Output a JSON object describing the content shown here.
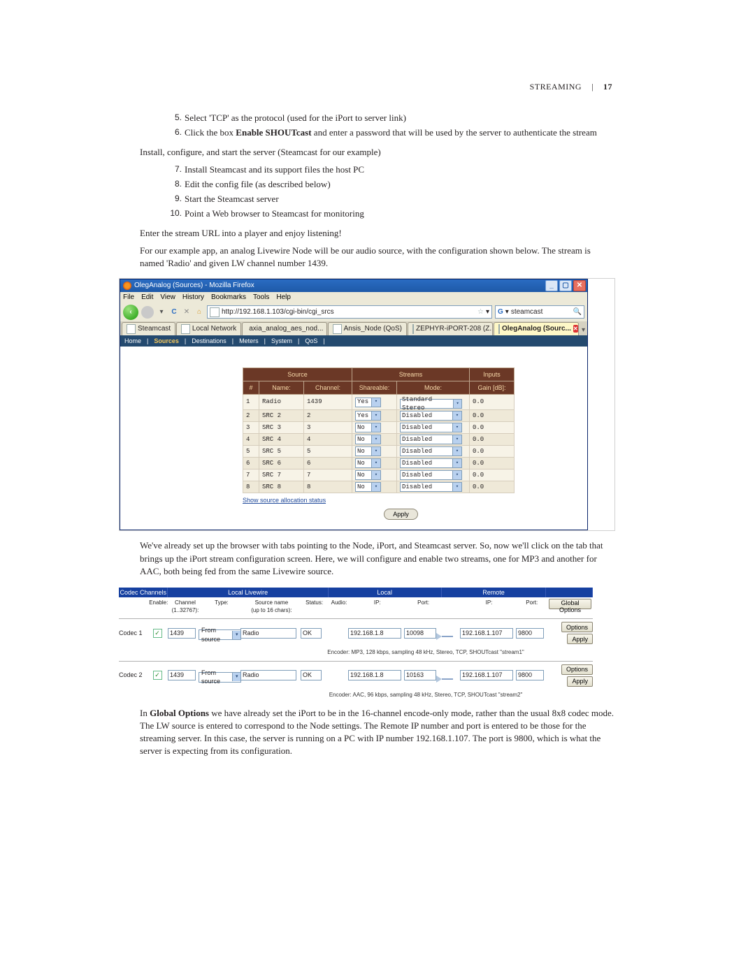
{
  "pageHeader": {
    "section": "STREAMING",
    "sep": "|",
    "pageNum": "17"
  },
  "instrFirst": [
    {
      "n": "5.",
      "text": "Select 'TCP' as the protocol (used for the iPort to server link)"
    },
    {
      "n": "6.",
      "text_pre": "Click the box ",
      "bold": "Enable SHOUTcast",
      "text_post": " and enter a password that will be used by the server to authenticate the stream"
    }
  ],
  "paraInstall": "Install, configure, and start the server (Steamcast for our example)",
  "instrSecond": [
    {
      "n": "7.",
      "text": "Install Steamcast and its support files the host PC"
    },
    {
      "n": "8.",
      "text": "Edit the config file (as described below)"
    },
    {
      "n": "9.",
      "text": "Start the Steamcast server"
    },
    {
      "n": "10.",
      "text": "Point a Web browser to Steamcast for monitoring"
    }
  ],
  "paraEnter": "Enter the stream URL into a player and enjoy listening!",
  "paraExample": "For our example app, an analog Livewire Node will be our audio source, with the configuration shown below. The stream is named 'Radio' and given LW channel number 1439.",
  "firefox": {
    "title": "OlegAnalog (Sources) - Mozilla Firefox",
    "menu": [
      "File",
      "Edit",
      "View",
      "History",
      "Bookmarks",
      "Tools",
      "Help"
    ],
    "url": "http://192.168.1.103/cgi-bin/cgi_srcs",
    "search": "steamcast",
    "tabs": [
      {
        "label": "Steamcast"
      },
      {
        "label": "Local Network"
      },
      {
        "label": "axia_analog_aes_nod..."
      },
      {
        "label": "Ansis_Node (QoS)"
      },
      {
        "label": "ZEPHYR-iPORT-208 (Z..."
      },
      {
        "label": "OlegAnalog (Sourc...",
        "active": true
      }
    ],
    "subnav": [
      "Home",
      "Sources",
      "Destinations",
      "Meters",
      "System",
      "QoS"
    ],
    "tableHead": {
      "group1": "Source",
      "group2": "Streams",
      "group3": "Inputs",
      "c_num": "#",
      "c_name": "Name:",
      "c_channel": "Channel:",
      "c_share": "Shareable:",
      "c_mode": "Mode:",
      "c_gain": "Gain [dB]:"
    },
    "rows": [
      {
        "n": "1",
        "name": "Radio",
        "chan": "1439",
        "share": "Yes",
        "mode": "Standard Stereo",
        "gain": "0.0"
      },
      {
        "n": "2",
        "name": "SRC 2",
        "chan": "2",
        "share": "Yes",
        "mode": "Disabled",
        "gain": "0.0"
      },
      {
        "n": "3",
        "name": "SRC 3",
        "chan": "3",
        "share": "No",
        "mode": "Disabled",
        "gain": "0.0"
      },
      {
        "n": "4",
        "name": "SRC 4",
        "chan": "4",
        "share": "No",
        "mode": "Disabled",
        "gain": "0.0"
      },
      {
        "n": "5",
        "name": "SRC 5",
        "chan": "5",
        "share": "No",
        "mode": "Disabled",
        "gain": "0.0"
      },
      {
        "n": "6",
        "name": "SRC 6",
        "chan": "6",
        "share": "No",
        "mode": "Disabled",
        "gain": "0.0"
      },
      {
        "n": "7",
        "name": "SRC 7",
        "chan": "7",
        "share": "No",
        "mode": "Disabled",
        "gain": "0.0"
      },
      {
        "n": "8",
        "name": "SRC 8",
        "chan": "8",
        "share": "No",
        "mode": "Disabled",
        "gain": "0.0"
      }
    ],
    "linkAlloc": "Show source allocation status",
    "apply": "Apply"
  },
  "paraBrowser": "We've already set up the browser with tabs pointing to the Node, iPort, and Steamcast server. So, now we'll click on the tab that brings up the iPort stream configuration screen. Here, we will  configure and enable two streams, one for MP3 and another for AAC, both being fed from the same Livewire source.",
  "codec": {
    "head": {
      "c1": "Codec Channels",
      "c2": "Local Livewire",
      "c3": "Local",
      "c4": "Remote"
    },
    "sub": {
      "enable": "Enable:",
      "channel_l1": "Channel",
      "channel_l2": "(1..32767):",
      "type": "Type:",
      "srcname_l1": "Source name",
      "srcname_l2": "(up to 16 chars):",
      "status": "Status:",
      "audio": "Audio:",
      "ip": "IP:",
      "port": "Port:",
      "rip": "IP:",
      "rport": "Port:",
      "global": "Global Options"
    },
    "rows": [
      {
        "label": "Codec 1",
        "chan": "1439",
        "type": "From source",
        "srcname": "Radio",
        "status": "OK",
        "ip": "192.168.1.8",
        "port": "10098",
        "rip": "192.168.1.107",
        "rport": "9800",
        "desc": "Encoder: MP3, 128 kbps, sampling 48 kHz, Stereo, TCP, SHOUTcast \"stream1\""
      },
      {
        "label": "Codec 2",
        "chan": "1439",
        "type": "From source",
        "srcname": "Radio",
        "status": "OK",
        "ip": "192.168.1.8",
        "port": "10163",
        "rip": "192.168.1.107",
        "rport": "9800",
        "desc": "Encoder: AAC, 96 kbps, sampling 48 kHz, Stereo, TCP, SHOUTcast \"stream2\""
      }
    ],
    "btnOptions": "Options",
    "btnApply": "Apply"
  },
  "paraGlobalPre": "In ",
  "paraGlobalBold": "Global Options",
  "paraGlobalPost": " we have already set the iPort to be in the 16-channel encode-only mode, rather than the usual 8x8 codec mode. The LW source is entered to correspond to the Node settings. The Remote IP number and port is entered to be those for the streaming server. In this case, the server is running on a PC with IP number 192.168.1.107. The port is 9800, which is what the server is expecting from its configuration."
}
